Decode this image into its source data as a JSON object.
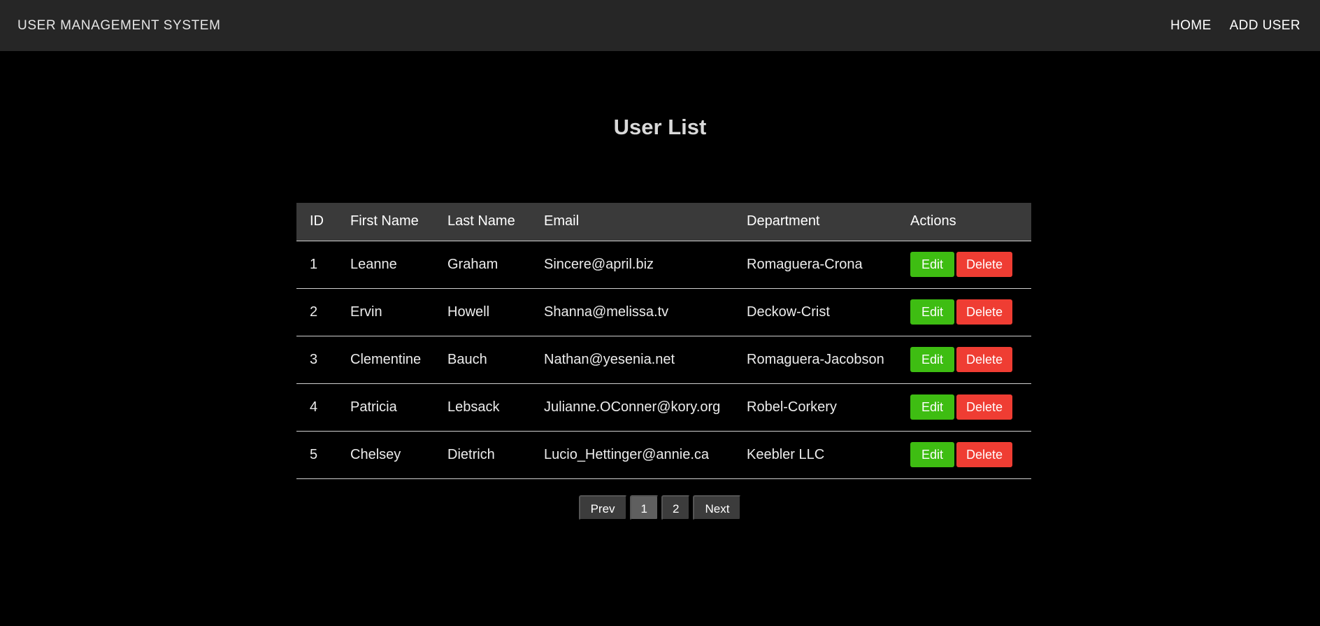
{
  "navbar": {
    "brand": "USER MANAGEMENT SYSTEM",
    "links": [
      "HOME",
      "ADD USER"
    ]
  },
  "page": {
    "title": "User List"
  },
  "table": {
    "columns": [
      "ID",
      "First Name",
      "Last Name",
      "Email",
      "Department",
      "Actions"
    ],
    "rows": [
      {
        "id": "1",
        "first": "Leanne",
        "last": "Graham",
        "email": "Sincere@april.biz",
        "department": "Romaguera-Crona"
      },
      {
        "id": "2",
        "first": "Ervin",
        "last": "Howell",
        "email": "Shanna@melissa.tv",
        "department": "Deckow-Crist"
      },
      {
        "id": "3",
        "first": "Clementine",
        "last": "Bauch",
        "email": "Nathan@yesenia.net",
        "department": "Romaguera-Jacobson"
      },
      {
        "id": "4",
        "first": "Patricia",
        "last": "Lebsack",
        "email": "Julianne.OConner@kory.org",
        "department": "Robel-Corkery"
      },
      {
        "id": "5",
        "first": "Chelsey",
        "last": "Dietrich",
        "email": "Lucio_Hettinger@annie.ca",
        "department": "Keebler LLC"
      }
    ],
    "edit_label": "Edit",
    "delete_label": "Delete"
  },
  "pagination": {
    "prev_label": "Prev",
    "pages": [
      "1",
      "2"
    ],
    "current_page": "1",
    "next_label": "Next"
  },
  "colors": {
    "navbar_bg": "#262626",
    "page_bg": "#000000",
    "edit_button": "#3ebd12",
    "delete_button": "#ef3d33",
    "table_header_bg": "#3a3a3a",
    "pager_active": "#5f5f5f"
  }
}
